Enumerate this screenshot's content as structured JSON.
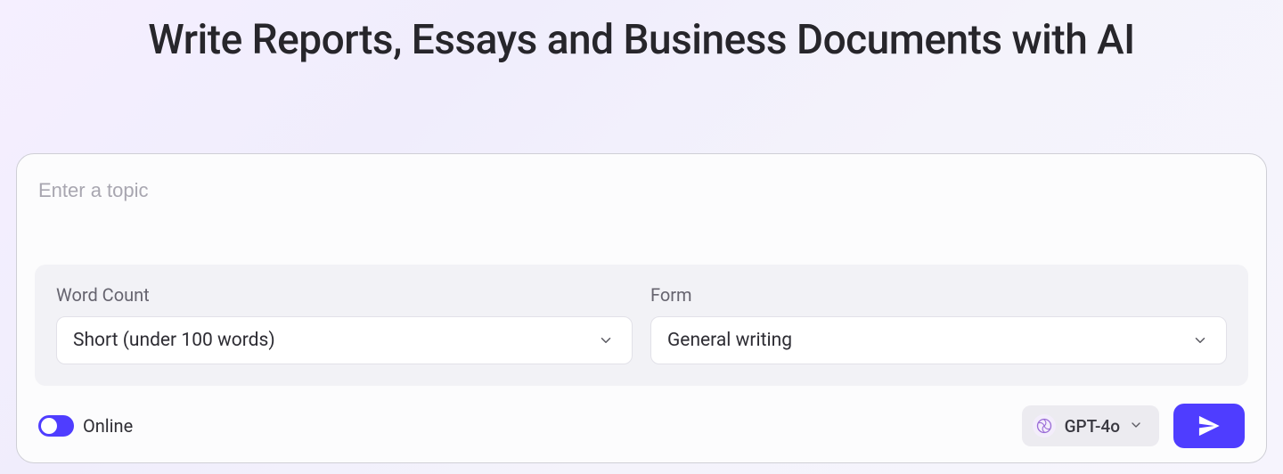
{
  "title": "Write Reports, Essays and Business Documents with AI",
  "topic": {
    "placeholder": "Enter a topic",
    "value": ""
  },
  "fields": {
    "word_count": {
      "label": "Word Count",
      "value": "Short (under 100 words)"
    },
    "form": {
      "label": "Form",
      "value": "General writing"
    }
  },
  "footer": {
    "online_label": "Online",
    "online_enabled": true,
    "model": "GPT-4o"
  },
  "colors": {
    "accent": "#4f3dff"
  }
}
